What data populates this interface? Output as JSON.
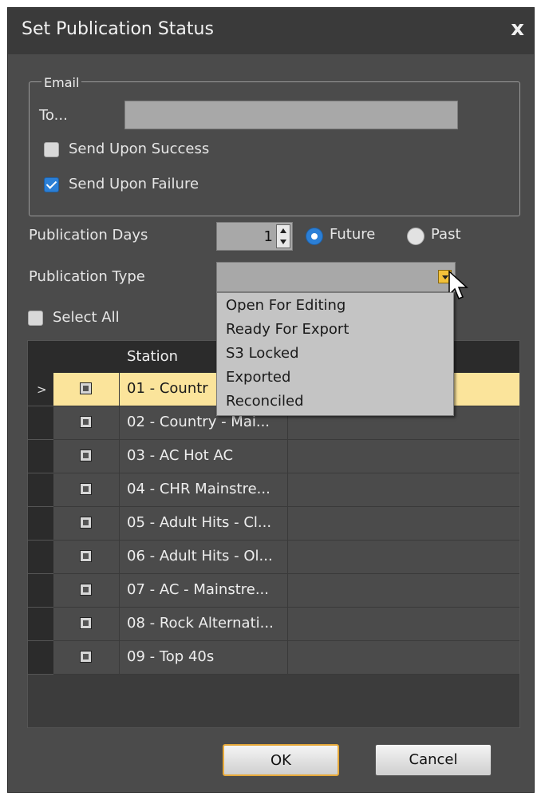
{
  "window": {
    "title": "Set Publication Status",
    "close_glyph": "x"
  },
  "email": {
    "group_label": "Email",
    "to_label": "To...",
    "to_value": "",
    "send_success": {
      "label": "Send Upon Success",
      "checked": false
    },
    "send_failure": {
      "label": "Send Upon Failure",
      "checked": true
    }
  },
  "publication_days": {
    "label": "Publication Days",
    "value": "1",
    "future": {
      "label": "Future",
      "selected": true
    },
    "past": {
      "label": "Past",
      "selected": false
    }
  },
  "publication_type": {
    "label": "Publication Type",
    "value": "",
    "options": [
      "Open For Editing",
      "Ready For Export",
      "S3 Locked",
      "Exported",
      "Reconciled"
    ]
  },
  "select_all": {
    "label": "Select All",
    "checked": false
  },
  "grid": {
    "column_station": "Station",
    "rows": [
      {
        "station": "01 - Countr",
        "selected": true
      },
      {
        "station": "02 - Country - Mai..."
      },
      {
        "station": "03 - AC Hot AC"
      },
      {
        "station": "04 - CHR Mainstre..."
      },
      {
        "station": "05 - Adult Hits - Cl..."
      },
      {
        "station": "06 - Adult Hits - Ol..."
      },
      {
        "station": "07 - AC - Mainstre..."
      },
      {
        "station": "08 - Rock Alternati..."
      },
      {
        "station": "09 - Top 40s"
      }
    ]
  },
  "buttons": {
    "ok": "OK",
    "cancel": "Cancel"
  },
  "colors": {
    "accent_blue": "#2b7fd6",
    "selection_yellow": "#fbe49b",
    "ok_border": "#e6a93a"
  }
}
